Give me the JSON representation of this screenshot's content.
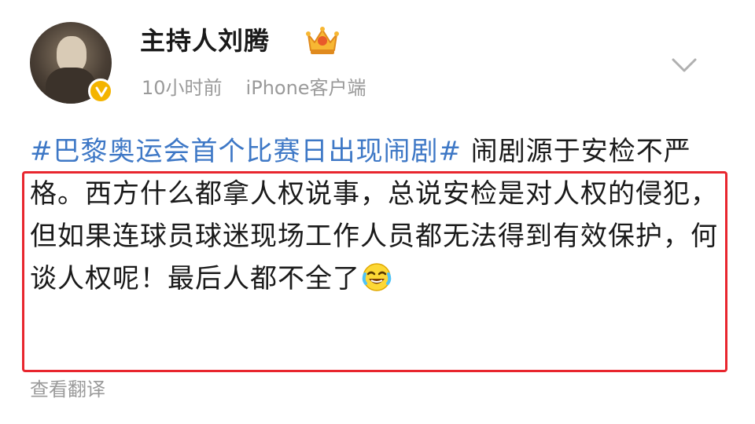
{
  "post": {
    "author": "主持人刘腾",
    "time": "10小时前",
    "source": "iPhone客户端",
    "topic": "#巴黎奥运会首个比赛日出现闹剧#",
    "text": " 闹剧源于安检不严格。西方什么都拿人权说事，总说安检是对人权的侵犯，但如果连球员球迷现场工作人员都无法得到有效保护，何谈人权呢！最后人都不全了",
    "translate_label": "查看翻译"
  },
  "colors": {
    "topic": "#3e78c6",
    "highlight_border": "#e8262e",
    "verified_badge": "#f4b400",
    "meta_text": "#9a9a9a"
  },
  "icons": {
    "verified": "verified-v-icon",
    "crown": "crown-icon",
    "chevron": "chevron-down-icon",
    "emoji": "laugh-cry-emoji-icon"
  }
}
